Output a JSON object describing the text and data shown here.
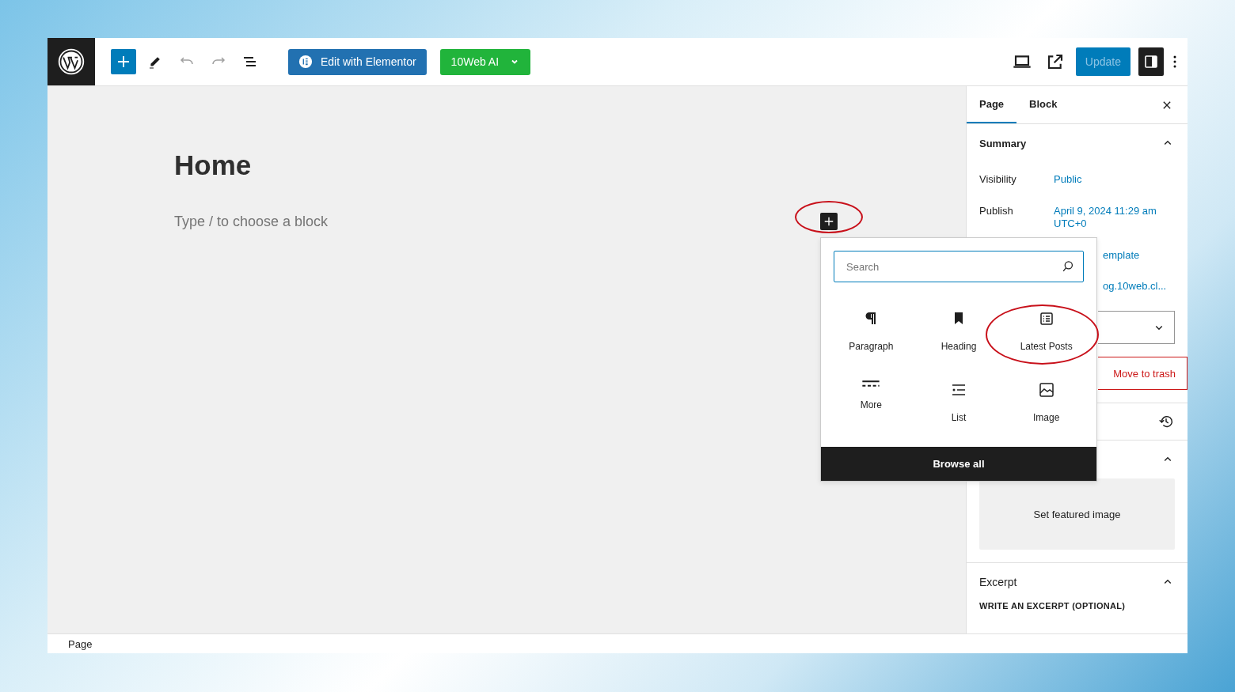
{
  "toolbar": {
    "tools": [
      {
        "kind": "add",
        "disabled": false
      },
      {
        "kind": "edit",
        "disabled": false
      },
      {
        "kind": "undo",
        "disabled": true
      },
      {
        "kind": "redo",
        "disabled": true
      },
      {
        "kind": "list-view",
        "disabled": false
      }
    ],
    "elementor_button": {
      "label": "Edit with Elementor"
    },
    "ai_button": {
      "label": "10Web AI"
    },
    "update_button": {
      "label": "Update",
      "disabled": true
    },
    "settings_toggle": {
      "pressed": true
    }
  },
  "canvas": {
    "title": "Home",
    "placeholder": "Type / to choose a block",
    "inline_inserter": {
      "highlighted": true
    }
  },
  "inserter": {
    "search": {
      "placeholder": "Search"
    },
    "blocks": [
      {
        "kind": "paragraph",
        "label": "Paragraph",
        "highlighted": false
      },
      {
        "kind": "heading",
        "label": "Heading",
        "highlighted": false
      },
      {
        "kind": "latest-posts",
        "label": "Latest Posts",
        "highlighted": true
      },
      {
        "kind": "more",
        "label": "More",
        "highlighted": false
      },
      {
        "kind": "list",
        "label": "List",
        "highlighted": false
      },
      {
        "kind": "image",
        "label": "Image",
        "highlighted": false
      }
    ],
    "browse_all": "Browse all"
  },
  "sidebar": {
    "tabs": [
      {
        "label": "Page",
        "selected": true
      },
      {
        "label": "Block",
        "selected": false
      }
    ],
    "summary": {
      "title": "Summary",
      "expanded": true,
      "rows": [
        {
          "label": "Visibility",
          "value": "Public"
        },
        {
          "label": "Publish",
          "value": "April 9, 2024 11:29 am UTC+0"
        }
      ],
      "covered_values": [
        "emplate",
        "og.10web.cl..."
      ],
      "trash_button": "Move to trash"
    },
    "featured_image": {
      "expanded": true,
      "button": "Set featured image"
    },
    "excerpt": {
      "title": "Excerpt",
      "expanded": true,
      "label": "WRITE AN EXCERPT (OPTIONAL)"
    }
  },
  "status_bar": {
    "breadcrumb": "Page"
  }
}
